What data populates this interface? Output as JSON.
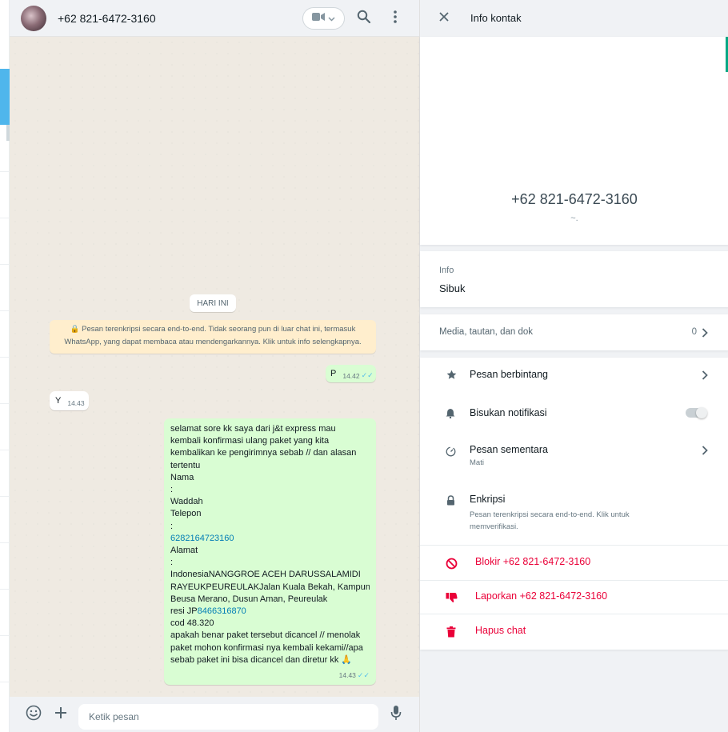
{
  "chat": {
    "contact_name": "+62 821-6472-3160",
    "day_label": "HARI INI",
    "encryption_notice_line1": "🔒 Pesan terenkripsi secara end-to-end. Tidak seorang pun di luar chat ini, termasuk",
    "encryption_notice_line2": "WhatsApp, yang dapat membaca atau mendengarkannya. Klik untuk info selengkapnya.",
    "messages": [
      {
        "text": "P",
        "time": "14.42",
        "ticks": "✓✓"
      },
      {
        "text": "Y",
        "time": "14.43"
      },
      {
        "lines": [
          "selamat sore kk saya dari j&t express mau",
          "kembali konfirmasi ulang paket yang  kita",
          "kembalikan ke pengirimnya sebab // dan alasan",
          "tertentu",
          "Nama",
          ":",
          "Waddah",
          "Telepon",
          ":",
          "6282164723160",
          "Alamat",
          ":",
          "IndonesiaNANGGROE ACEH DARUSSALAMIDI",
          "RAYEUKPEUREULAKJalan Kuala Bekah, Kampung",
          "Beusa Merano, Dusun Aman, Peureulak",
          "resi JP",
          "8466316870",
          "cod  48.320",
          "apakah benar paket tersebut  dicancel // menolak",
          "paket mohon konfirmasi nya kembali kekami//apa",
          "sebab paket ini bisa dicancel dan diretur kk 🙏"
        ],
        "time": "14.43",
        "ticks": "✓✓"
      }
    ],
    "input_placeholder": "Ketik pesan"
  },
  "info": {
    "title": "Info kontak",
    "profile_name": "+62 821-6472-3160",
    "profile_sub": "~.",
    "about_label": "Info",
    "about_value": "Sibuk",
    "media_label": "Media, tautan, dan dok",
    "media_count": "0",
    "options": {
      "starred": "Pesan berbintang",
      "mute": "Bisukan notifikasi",
      "disappearing": "Pesan sementara",
      "disappearing_sub": "Mati",
      "encryption": "Enkripsi",
      "encryption_sub": "Pesan terenkripsi secara end-to-end. Klik untuk memverifikasi.",
      "block": "Blokir +62 821-6472-3160",
      "report": "Laporkan +62 821-6472-3160",
      "delete": "Hapus chat"
    }
  },
  "colors": {
    "outgoing_bubble": "#d9fdd3",
    "danger": "#ea0038",
    "link": "#027eb5",
    "read_ticks": "#53bdeb"
  }
}
